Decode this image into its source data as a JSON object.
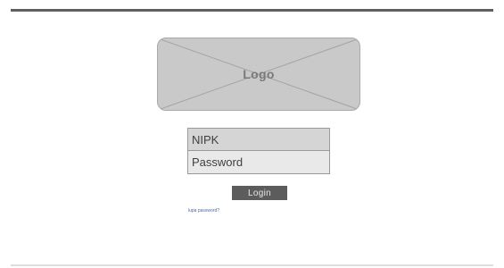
{
  "logo": {
    "label": "Logo"
  },
  "form": {
    "nipk_label": "NIPK",
    "password_label": "Password",
    "login_button": "Login",
    "forgot_password": "lupa password?"
  }
}
